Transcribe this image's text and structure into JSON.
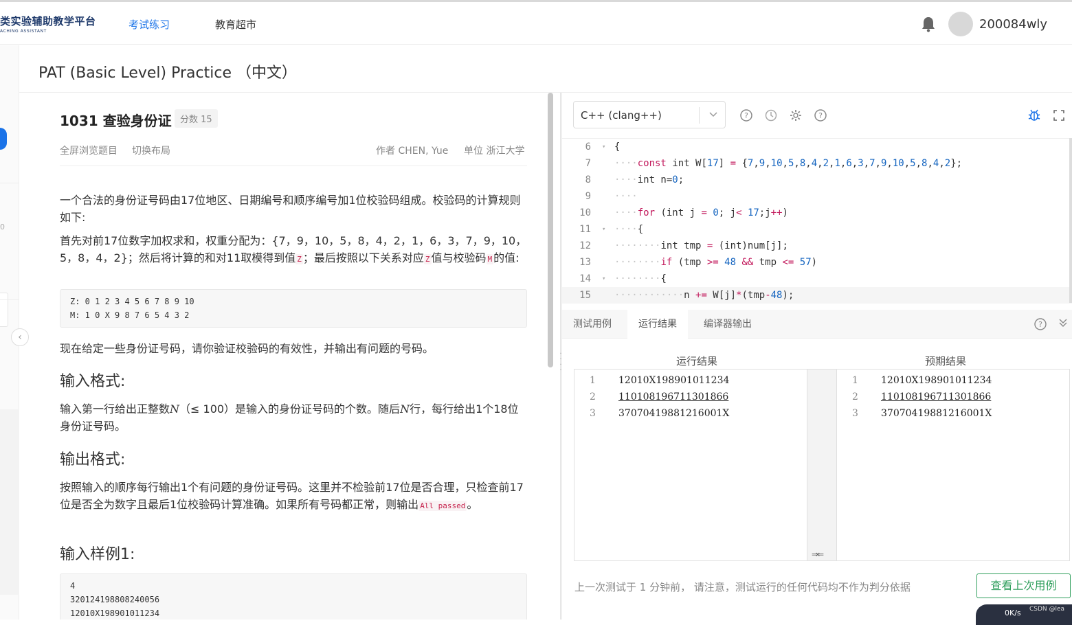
{
  "header": {
    "logo_main": "类实验辅助教学平台",
    "logo_sub": "ACHING ASSISTANT",
    "nav": [
      {
        "label": "考试练习"
      },
      {
        "label": "教育超市"
      }
    ],
    "username": "200084wly",
    "accent_color": "#1a73e8"
  },
  "sidebar": {
    "mini_text": "0"
  },
  "page": {
    "title": "PAT (Basic Level) Practice （中文）"
  },
  "problem": {
    "title": "1031 查验身份证",
    "score": "分数 15",
    "actions": [
      "全屏浏览题目",
      "切换布局"
    ],
    "author": "作者 CHEN, Yue",
    "unit": "单位 浙江大学",
    "desc1": "一个合法的身份证号码由17位地区、日期编号和顺序编号加1位校验码组成。校验码的计算规则如下:",
    "desc2_a": "首先对前17位数字加权求和，权重分配为：{7，9，10，5，8，4，2，1，6，3，7，9，10，5，8，4，2}；然后将计算的和对11取模得到值",
    "desc2_code1": "Z",
    "desc2_b": "；最后按照以下关系对应",
    "desc2_code2": "Z",
    "desc2_c": "值与校验码",
    "desc2_code3": "M",
    "desc2_d": "的值:",
    "table_pre": "Z: 0 1 2 3 4 5 6 7 8 9 10\nM: 1 0 X 9 8 7 6 5 4 3 2",
    "desc3": "现在给定一些身份证号码，请你验证校验码的有效性，并输出有问题的号码。",
    "input_heading": "输入格式:",
    "input_a": "输入第一行给出正整数",
    "input_var1": "N",
    "input_b": "（≤ 100）是输入的身份证号码的个数。随后",
    "input_var2": "N",
    "input_c": "行，每行给出1个18位身份证号码。",
    "output_heading": "输出格式:",
    "output_a": "按照输入的顺序每行输出1个有问题的身份证号码。这里并不检验前17位是否合理，只检查前17位是否全为数字且最后1位校验码计算准确。如果所有号码都正常，则输出",
    "output_code": "All passed",
    "output_b": "。",
    "sample_heading": "输入样例1:",
    "sample_pre": "4\n320124198808240056\n12010X198901011234"
  },
  "editor": {
    "language": "C++ (clang++)",
    "toolbar_icons": [
      "help-icon",
      "history-icon",
      "settings-icon",
      "question-icon",
      "debug-icon",
      "fullscreen-icon"
    ],
    "code_lines": [
      {
        "n": "6",
        "fold": "▾",
        "html": "{"
      },
      {
        "n": "7",
        "fold": "",
        "html": "<span class='ws'>····</span><span class='kw'>const</span> int W[<span class='num'>17</span>] <span class='op'>=</span> {<span class='num'>7</span>,<span class='num'>9</span>,<span class='num'>10</span>,<span class='num'>5</span>,<span class='num'>8</span>,<span class='num'>4</span>,<span class='num'>2</span>,<span class='num'>1</span>,<span class='num'>6</span>,<span class='num'>3</span>,<span class='num'>7</span>,<span class='num'>9</span>,<span class='num'>10</span>,<span class='num'>5</span>,<span class='num'>8</span>,<span class='num'>4</span>,<span class='num'>2</span>};"
      },
      {
        "n": "8",
        "fold": "",
        "html": "<span class='ws'>····</span>int n=<span class='num'>0</span>;"
      },
      {
        "n": "9",
        "fold": "",
        "html": "<span class='ws'>····</span>"
      },
      {
        "n": "10",
        "fold": "",
        "html": "<span class='ws'>····</span><span class='kw'>for</span> (int j <span class='op'>=</span> <span class='num'>0</span>; j<span class='op'>&lt;</span> <span class='num'>17</span>;j<span class='op'>++</span>)"
      },
      {
        "n": "11",
        "fold": "▾",
        "html": "<span class='ws'>····</span>{"
      },
      {
        "n": "12",
        "fold": "",
        "html": "<span class='ws'>········</span>int tmp <span class='op'>=</span> (int)num[j];"
      },
      {
        "n": "13",
        "fold": "",
        "html": "<span class='ws'>········</span><span class='kw'>if</span> (tmp <span class='op'>&gt;=</span> <span class='num'>48</span> <span class='op'>&amp;&amp;</span> tmp <span class='op'>&lt;=</span> <span class='num'>57</span>)"
      },
      {
        "n": "14",
        "fold": "▾",
        "html": "<span class='ws'>········</span>{"
      },
      {
        "n": "15",
        "fold": "",
        "html": "<span class='ws'>············</span>n <span class='op'>+=</span> W[j]<span class='op'>*</span>(tmp<span class='op'>-</span><span class='num'>48</span>);"
      }
    ],
    "tabs": [
      "测试用例",
      "运行结果",
      "编译器输出"
    ],
    "active_tab": 1,
    "run_result_head": "运行结果",
    "expected_head": "预期结果",
    "run_result": [
      {
        "n": "1",
        "text": "12010X198901011234",
        "diff": false
      },
      {
        "n": "2",
        "text": "110108196711301866",
        "diff": true
      },
      {
        "n": "3",
        "text": "37070419881216001X",
        "diff": false
      }
    ],
    "expected": [
      {
        "n": "1",
        "text": "12010X198901011234",
        "diff": false
      },
      {
        "n": "2",
        "text": "110108196711301866",
        "diff": true
      },
      {
        "n": "3",
        "text": "37070419881216001X",
        "diff": false
      }
    ],
    "footer_note": "上一次测试于 1 分钟前， 请注意，测试运行的任何代码均不作为判分依据",
    "last_button": "查看上次用例",
    "button_color": "#2e9e5b"
  },
  "overlay": {
    "net_speed": "0K/s",
    "watermark": "CSDN @lea"
  }
}
